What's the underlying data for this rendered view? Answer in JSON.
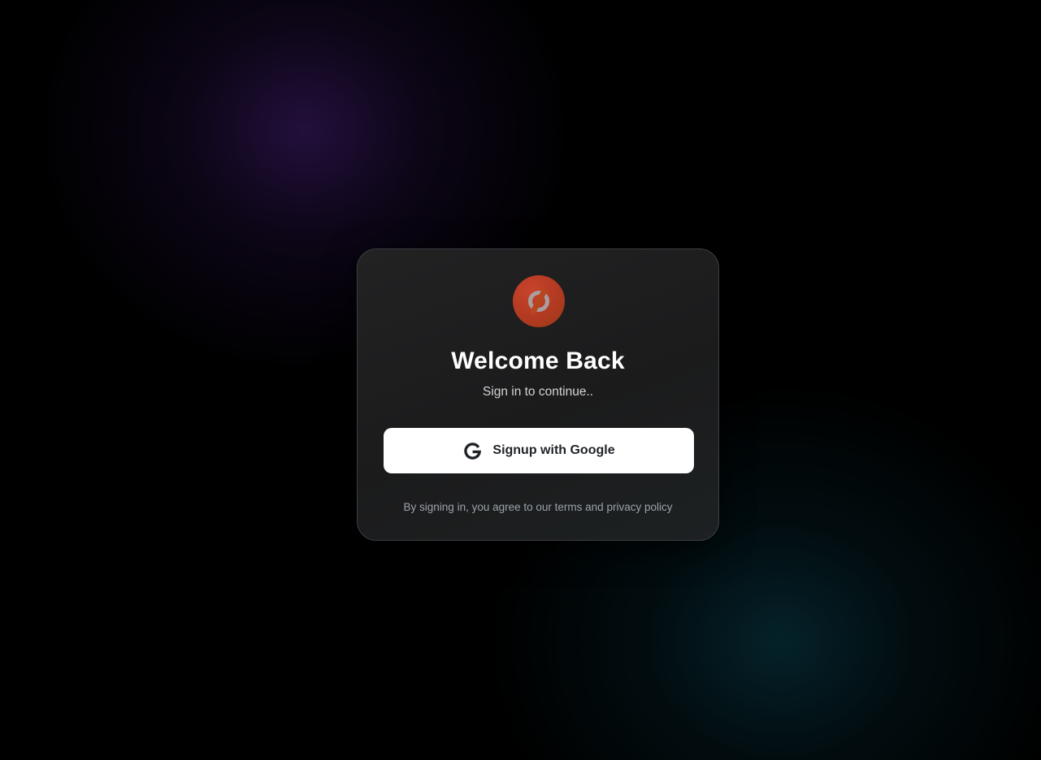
{
  "colors": {
    "background": "#000000",
    "card_background": "#1c1c1d",
    "card_border": "#3b3e42",
    "logo_accent": "#b23a22",
    "button_background": "#ffffff",
    "button_text": "#1f2328",
    "title_text": "#ffffff",
    "subtitle_text": "#d0d3d6",
    "legal_text": "#9ca3ab",
    "glow_top_left": "#1a0f2e",
    "glow_bottom_right": "#042a33"
  },
  "login": {
    "logo_icon": "slashed-circle-logo",
    "title": "Welcome Back",
    "subtitle": "Sign in to continue..",
    "google_button": {
      "icon": "google-icon",
      "label": "Signup with Google"
    },
    "legal": {
      "prefix": "By signing in, you agree to our ",
      "terms": "terms",
      "joiner": " and ",
      "privacy": "privacy policy"
    }
  }
}
